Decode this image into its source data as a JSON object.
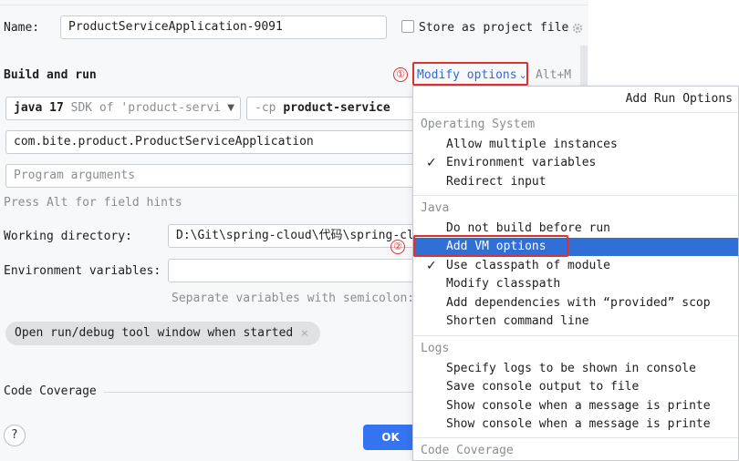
{
  "form": {
    "name_label": "Name:",
    "name_value": "ProductServiceApplication-9091",
    "store_label": "Store as project file",
    "build_run_title": "Build and run",
    "modify_options": "Modify options",
    "modify_chevron": "⌄",
    "modify_shortcut": "Alt+M",
    "jdk_version": "java 17",
    "jdk_desc": "SDK of 'product-servi",
    "cp_prefix": "-cp",
    "cp_value": "product-service",
    "main_class": "com.bite.product.ProductServiceApplication",
    "program_args_placeholder": "Program arguments",
    "field_hints": "Press Alt for field hints",
    "working_dir_label": "Working directory:",
    "working_dir_value": "D:\\Git\\spring-cloud\\代码\\spring-cl",
    "env_vars_label": "Environment variables:",
    "env_vars_hint": "Separate variables with semicolon:",
    "open_tool_window": "Open run/debug tool window when started",
    "pill_close": "×",
    "code_coverage_title": "Code Coverage",
    "help": "?",
    "ok": "OK"
  },
  "annotations": {
    "one": "①",
    "two": "②"
  },
  "popup": {
    "title": "Add Run Options",
    "groups": {
      "os": "Operating System",
      "java": "Java",
      "logs": "Logs",
      "coverage": "Code Coverage"
    },
    "os_items": [
      {
        "label": "Allow multiple instances",
        "check": ""
      },
      {
        "label": "Environment variables",
        "check": "✓"
      },
      {
        "label": "Redirect input",
        "check": ""
      }
    ],
    "java_items": [
      {
        "label": "Do not build before run",
        "check": ""
      },
      {
        "label": "Add VM options",
        "check": ""
      },
      {
        "label": "Use classpath of module",
        "check": "✓"
      },
      {
        "label": "Modify classpath",
        "check": ""
      },
      {
        "label": "Add dependencies with “provided” scop",
        "check": ""
      },
      {
        "label": "Shorten command line",
        "check": ""
      }
    ],
    "log_items": [
      {
        "label": "Specify logs to be shown in console",
        "check": ""
      },
      {
        "label": "Save console output to file",
        "check": ""
      },
      {
        "label": "Show console when a message is printe",
        "check": ""
      },
      {
        "label": "Show console when a message is printe",
        "check": ""
      }
    ]
  },
  "colors": {
    "accent": "#3574f0",
    "selection": "#2f6fd6",
    "annotation": "#e03131",
    "link": "#2e6bd6"
  }
}
